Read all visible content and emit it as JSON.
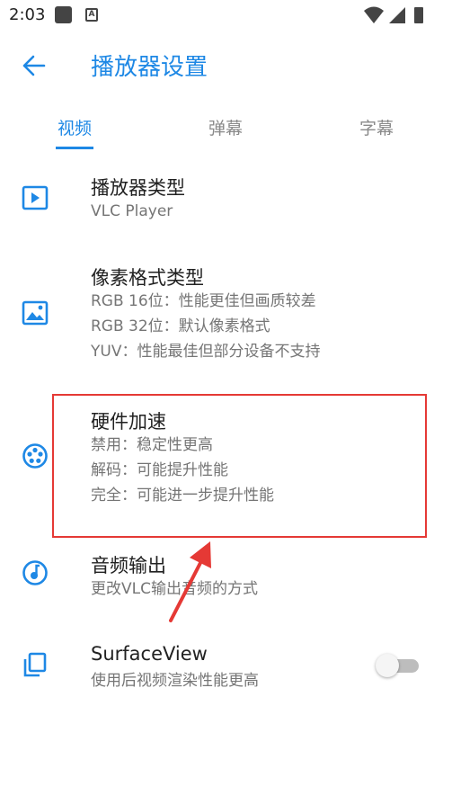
{
  "status_bar": {
    "time": "2:03",
    "icons": [
      "notification-square-icon",
      "a-badge-icon",
      "wifi-icon",
      "signal-icon",
      "battery-icon"
    ]
  },
  "app_bar": {
    "title": "播放器设置",
    "back_icon": "arrow-left-icon"
  },
  "tabs": [
    {
      "label": "视频",
      "active": true
    },
    {
      "label": "弹幕",
      "active": false
    },
    {
      "label": "字幕",
      "active": false
    }
  ],
  "settings": [
    {
      "icon": "play-box-icon",
      "title": "播放器类型",
      "lines": [
        "VLC Player"
      ]
    },
    {
      "icon": "image-icon",
      "title": "像素格式类型",
      "lines": [
        "RGB 16位：性能更佳但画质较差",
        "RGB 32位：默认像素格式",
        "YUV：性能最佳但部分设备不支持"
      ]
    },
    {
      "icon": "film-reel-icon",
      "title": "硬件加速",
      "lines": [
        "禁用：稳定性更高",
        "解码：可能提升性能",
        "完全：可能进一步提升性能"
      ]
    },
    {
      "icon": "audio-dial-icon",
      "title": "音频输出",
      "lines": [
        "更改VLC输出音频的方式"
      ]
    },
    {
      "icon": "copy-icon",
      "title": "SurfaceView",
      "lines": [
        "使用后视频渲染性能更高"
      ],
      "toggle_on": false
    }
  ],
  "colors": {
    "accent": "#1E88E5",
    "highlight": "#e53935",
    "arrow": "#e53935"
  }
}
